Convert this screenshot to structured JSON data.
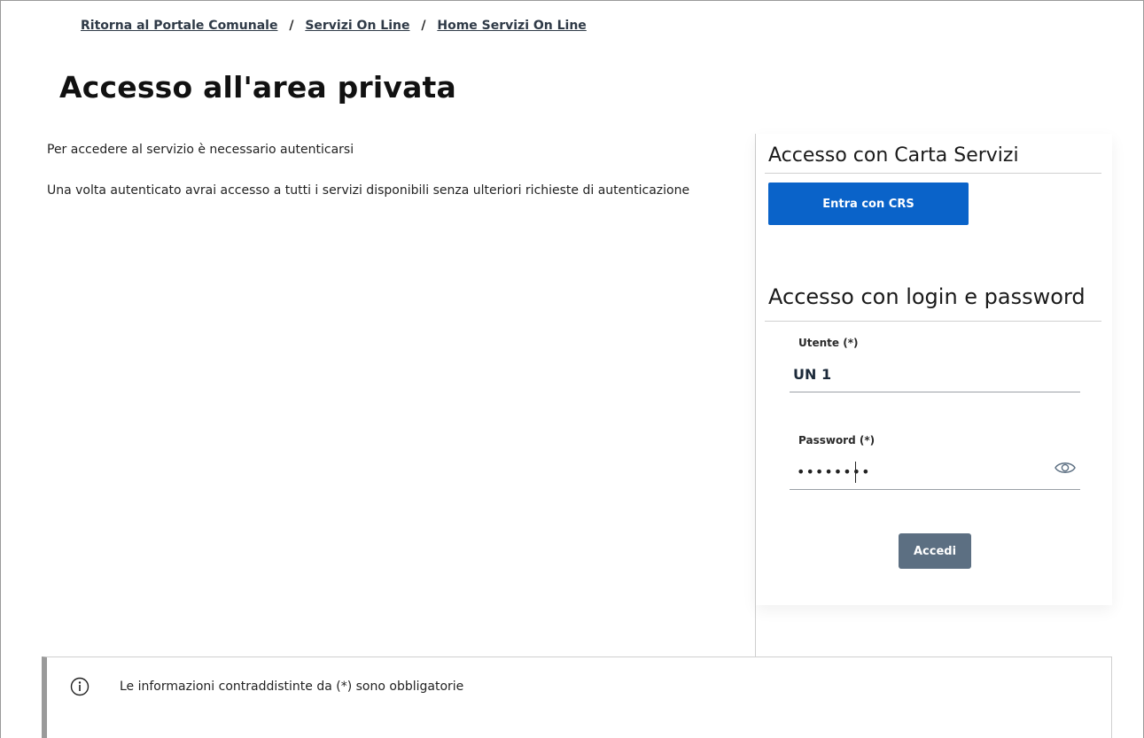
{
  "breadcrumb": {
    "items": [
      "Ritorna al Portale Comunale",
      "Servizi On Line",
      "Home Servizi On Line"
    ],
    "separator": "/"
  },
  "page": {
    "title": "Accesso all'area privata"
  },
  "intro": {
    "line1": "Per accedere al servizio è necessario autenticarsi",
    "line2": "Una volta autenticato avrai accesso a tutti i servizi disponibili senza ulteriori richieste di autenticazione"
  },
  "crs": {
    "title": "Accesso con Carta Servizi",
    "button_label": "Entra con CRS"
  },
  "login": {
    "title": "Accesso con login e password",
    "user_label": "Utente (*)",
    "user_value": "UN 1",
    "password_label": "Password (*)",
    "password_value": "••••••••",
    "submit_label": "Accedi",
    "show_password_icon": "eye-icon"
  },
  "info": {
    "icon": "info-icon",
    "text": "Le informazioni contraddistinte da (*) sono obbligatorie"
  },
  "colors": {
    "crs_button": "#0a63c9",
    "accedi_button": "#5c6f82",
    "link": "#2f3a47"
  }
}
